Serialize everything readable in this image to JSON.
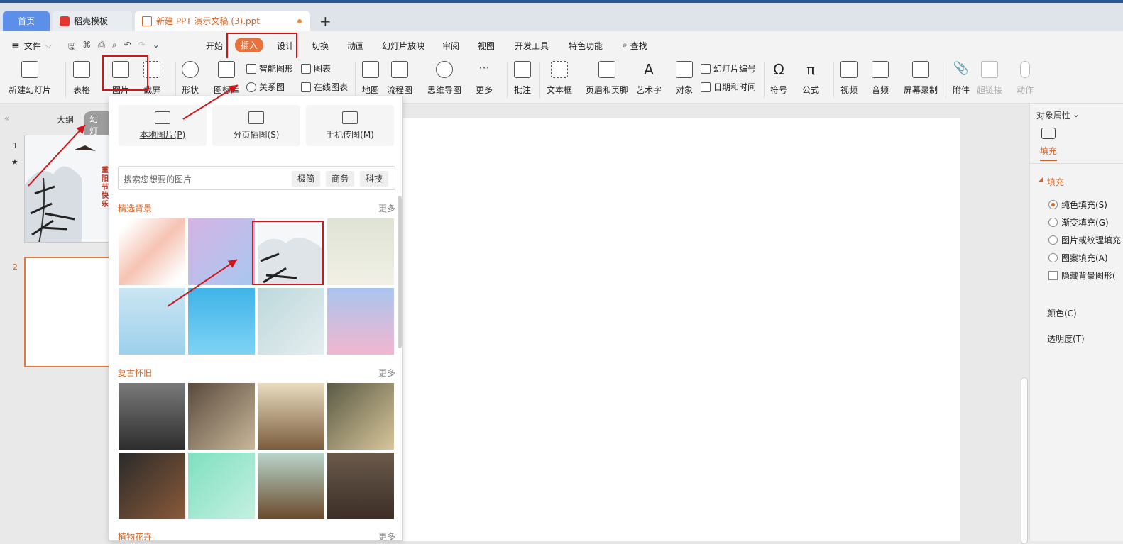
{
  "tabs": {
    "home": "首页",
    "daoke": "稻壳模板",
    "doc": "新建 PPT 演示文稿 (3).ppt",
    "add": "+"
  },
  "menu": {
    "file": "文件",
    "items": [
      "开始",
      "插入",
      "设计",
      "切换",
      "动画",
      "幻灯片放映",
      "审阅",
      "视图",
      "开发工具",
      "特色功能"
    ],
    "search": "查找"
  },
  "ribbon": {
    "new_slide": "新建幻灯片",
    "table": "表格",
    "picture": "图片",
    "screenshot": "截屏",
    "shape": "形状",
    "icon_lib": "图标库",
    "smart_art": "智能图形",
    "chart": "图表",
    "relation": "关系图",
    "online_chart": "在线图表",
    "map": "地图",
    "flowchart": "流程图",
    "mindmap": "思维导图",
    "more": "更多",
    "comment": "批注",
    "textbox": "文本框",
    "header_footer": "页眉和页脚",
    "wordart": "艺术字",
    "object": "对象",
    "slide_num": "幻灯片编号",
    "datetime": "日期和时间",
    "symbol": "符号",
    "formula": "公式",
    "video": "视频",
    "audio": "音频",
    "screen_rec": "屏幕录制",
    "attach": "附件",
    "hyperlink": "超链接",
    "action": "动作"
  },
  "left": {
    "outline": "大纲",
    "slides": "幻灯",
    "slide1_no": "1",
    "slide2_no": "2",
    "slide1_text": "重阳节快乐"
  },
  "popup": {
    "local": "本地图片(P)",
    "page": "分页插图(S)",
    "phone": "手机传图(M)",
    "search_placeholder": "搜索您想要的图片",
    "tags": [
      "极简",
      "商务",
      "科技"
    ],
    "sec1": "精选背景",
    "sec2": "复古怀旧",
    "sec3": "植物花卉",
    "more": "更多"
  },
  "right": {
    "title": "对象属性",
    "tab": "填充",
    "section": "填充",
    "opts": [
      "纯色填充(S)",
      "渐变填充(G)",
      "图片或纹理填充",
      "图案填充(A)"
    ],
    "hide_bg": "隐藏背景图形(",
    "color": "颜色(C)",
    "transparency": "透明度(T)"
  }
}
